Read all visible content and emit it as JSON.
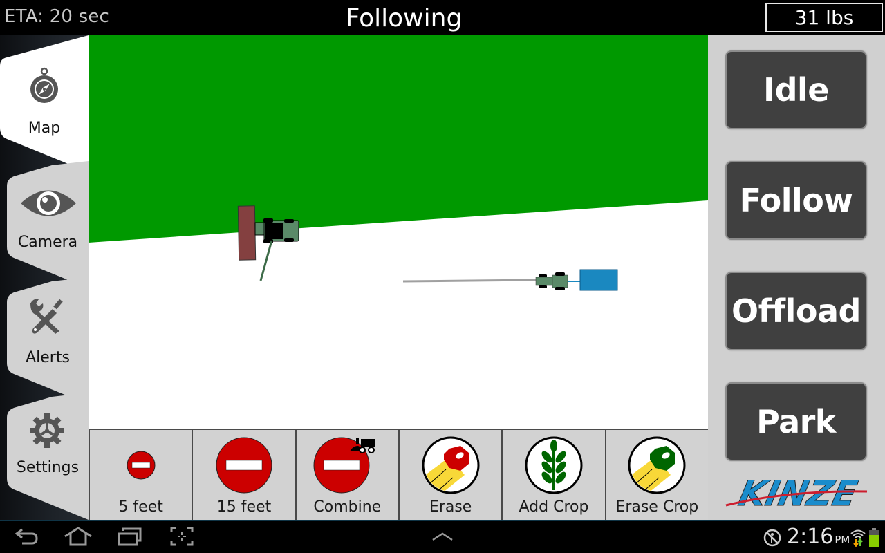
{
  "header": {
    "eta": "ETA: 20 sec",
    "status": "Following",
    "weight": "31 lbs"
  },
  "sidebar": {
    "tabs": [
      {
        "label": "Map",
        "icon": "compass-icon",
        "active": true
      },
      {
        "label": "Camera",
        "icon": "eye-icon",
        "active": false
      },
      {
        "label": "Alerts",
        "icon": "tools-icon",
        "active": false
      },
      {
        "label": "Settings",
        "icon": "gear-icon",
        "active": false
      }
    ]
  },
  "map": {
    "colors": {
      "crop": "#009900",
      "harvested": "#ffffff",
      "combine_header": "#844040",
      "vehicle_body": "#5a8a68",
      "grain_cart": "#1a88c0",
      "auger": "#a0a0a0"
    },
    "vehicles": [
      {
        "name": "combine",
        "label": "Combine"
      },
      {
        "name": "tractor-with-grain-cart",
        "label": "Tractor"
      }
    ]
  },
  "tools": [
    {
      "label": "5 feet",
      "icon": "no-entry-small-icon"
    },
    {
      "label": "15 feet",
      "icon": "no-entry-large-icon"
    },
    {
      "label": "Combine",
      "icon": "no-entry-combine-icon"
    },
    {
      "label": "Erase",
      "icon": "eraser-red-icon"
    },
    {
      "label": "Add Crop",
      "icon": "wheat-icon"
    },
    {
      "label": "Erase Crop",
      "icon": "eraser-green-icon"
    }
  ],
  "modes": [
    {
      "label": "Idle"
    },
    {
      "label": "Follow"
    },
    {
      "label": "Offload"
    },
    {
      "label": "Park"
    }
  ],
  "brand": {
    "logo_text": "KINZE",
    "logo_color": "#1a8ccc",
    "stripe_color": "#cc1e2e"
  },
  "system": {
    "time": "2:16",
    "ampm": "PM",
    "nav": [
      "back-icon",
      "home-icon",
      "recent-apps-icon",
      "screenshot-icon"
    ],
    "battery_color": "#88cc00"
  }
}
